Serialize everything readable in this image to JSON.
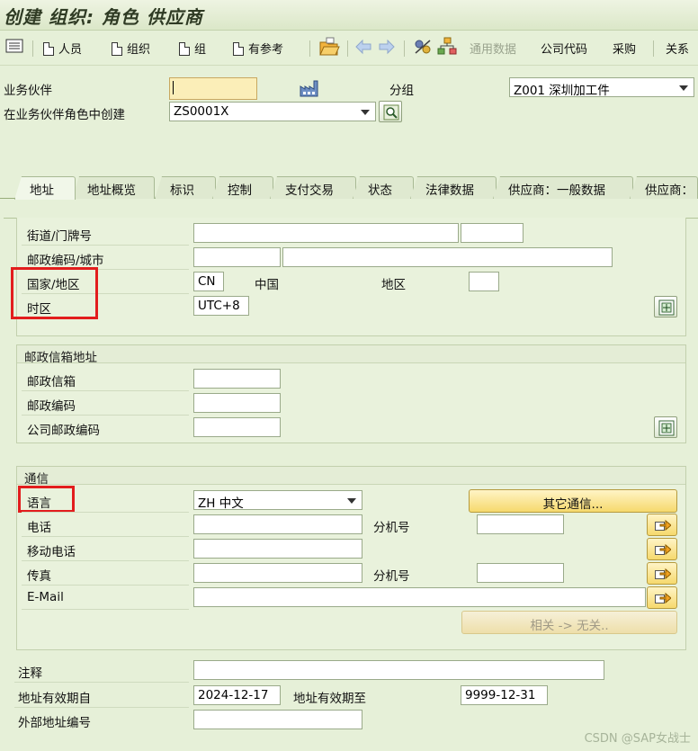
{
  "title": "创建 组织: 角色 供应商",
  "toolbar": {
    "person": "人员",
    "org": "组织",
    "group": "组",
    "with_ref": "有参考",
    "general_data": "通用数据",
    "company_code": "公司代码",
    "purchasing": "采购",
    "relations": "关系"
  },
  "header": {
    "bp_label": "业务伙伴",
    "bp_value": "",
    "group_label": "分组",
    "group_value": "Z001 深圳加工件",
    "create_in_role_label": "在业务伙伴角色中创建",
    "role_value": "ZS0001X"
  },
  "tabs": [
    "地址",
    "地址概览",
    "标识",
    "控制",
    "支付交易",
    "状态",
    "法律数据",
    "供应商：一般数据",
    "供应商："
  ],
  "address": {
    "street_label": "街道/门牌号",
    "postal_city_label": "邮政编码/城市",
    "country_label": "国家/地区",
    "country_code": "CN",
    "country_name": "中国",
    "region_label": "地区",
    "timezone_label": "时区",
    "timezone_value": "UTC+8"
  },
  "pobox": {
    "title": "邮政信箱地址",
    "pobox_label": "邮政信箱",
    "postal_code_label": "邮政编码",
    "company_postal_label": "公司邮政编码"
  },
  "comm": {
    "title": "通信",
    "language_label": "语言",
    "language_value": "ZH 中文",
    "other_button": "其它通信...",
    "phone_label": "电话",
    "ext_label": "分机号",
    "mobile_label": "移动电话",
    "fax_label": "传真",
    "fax_ext_label": "分机号",
    "email_label": "E-Mail",
    "related_button": "相关 -> 无关.."
  },
  "footer": {
    "notes_label": "注释",
    "valid_from_label": "地址有效期自",
    "valid_from_value": "2024-12-17",
    "valid_to_label": "地址有效期至",
    "valid_to_value": "9999-12-31",
    "ext_addr_label": "外部地址编号"
  },
  "watermark": "CSDN @SAP女战士",
  "colors": {
    "highlight": "#e21d1d",
    "required_field": "#fbeeb8",
    "background": "#e6f0d8"
  }
}
